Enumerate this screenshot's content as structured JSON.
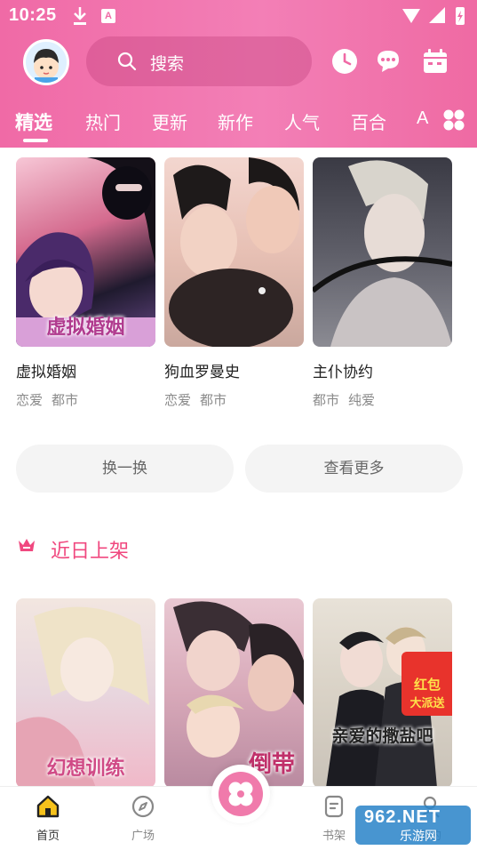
{
  "status_bar": {
    "time": "10:25",
    "notification_badge": "A"
  },
  "header": {
    "search_placeholder": "搜索",
    "icons": [
      "clock-icon",
      "chat-icon",
      "calendar-icon"
    ]
  },
  "tabs": [
    {
      "label": "精选",
      "active": true
    },
    {
      "label": "热门"
    },
    {
      "label": "更新"
    },
    {
      "label": "新作"
    },
    {
      "label": "人气"
    },
    {
      "label": "百合"
    },
    {
      "label": "A"
    }
  ],
  "featured": [
    {
      "title": "虚拟婚姻",
      "tags": [
        "恋爱",
        "都市"
      ],
      "cover_caption": "虚拟婚姻"
    },
    {
      "title": "狗血罗曼史",
      "tags": [
        "恋爱",
        "都市"
      ]
    },
    {
      "title": "主仆协约",
      "tags": [
        "都市",
        "纯爱"
      ]
    }
  ],
  "actions": {
    "refresh": "换一换",
    "more": "查看更多"
  },
  "section": {
    "title": "近日上架"
  },
  "new_arrivals": [
    {
      "cover_caption": "幻想训练"
    },
    {
      "cover_caption": "倒带"
    },
    {
      "cover_caption": "亲爱的撒盐吧",
      "badge_line1": "红包",
      "badge_line2": "大派送"
    }
  ],
  "bottom_nav": [
    {
      "label": "首页",
      "active": true
    },
    {
      "label": "广场"
    },
    {
      "label": ""
    },
    {
      "label": "书架"
    },
    {
      "label": "我的"
    }
  ],
  "watermark": {
    "top": "962.NET",
    "bottom": "乐游网"
  },
  "colors": {
    "accent": "#f06aa6",
    "section_title": "#f0487f",
    "tag_text": "#8a8a8a"
  }
}
